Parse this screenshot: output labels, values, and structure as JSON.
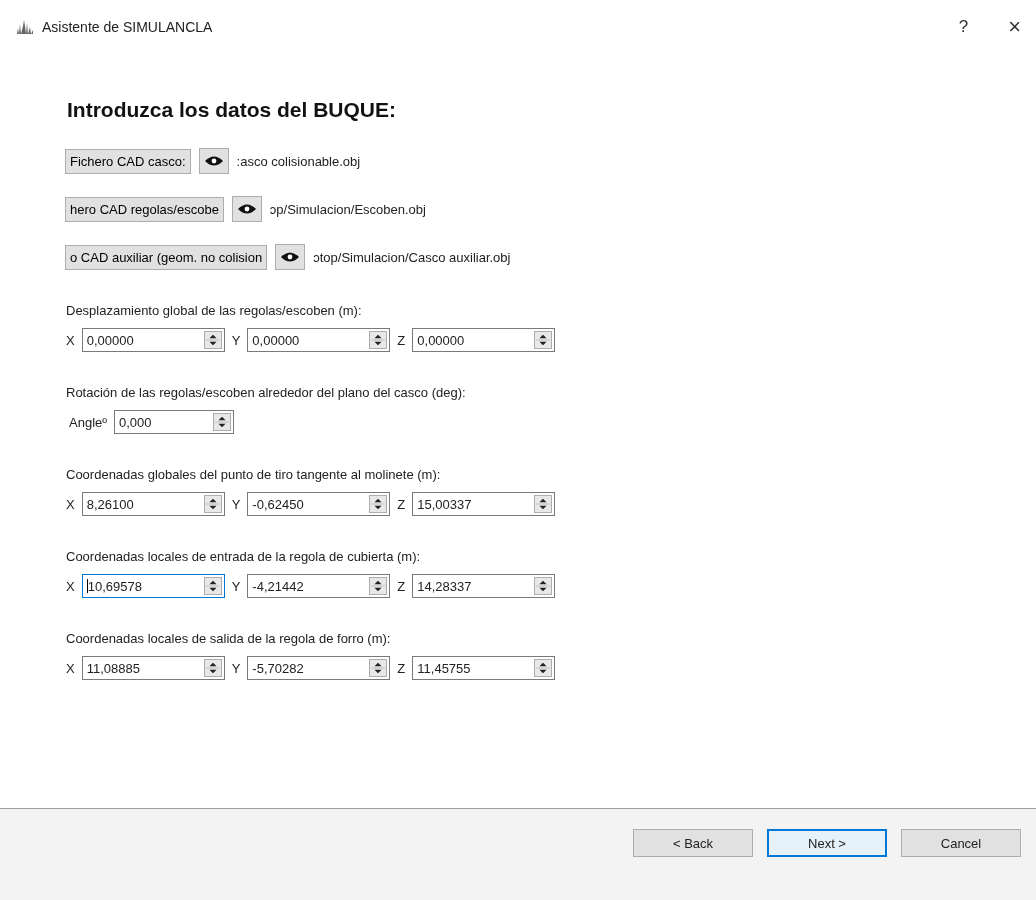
{
  "window": {
    "title": "Asistente de SIMULANCLA",
    "help": "?",
    "close": "×"
  },
  "heading": "Introduzca los datos del BUQUE:",
  "files": [
    {
      "button": "Fichero CAD casco:",
      "path": ":asco colisionable.obj"
    },
    {
      "button": "hero CAD regolas/escobe",
      "path": "ɔp/Simulacion/Escoben.obj"
    },
    {
      "button": "o CAD auxiliar (geom. no colision",
      "path": "ɔtop/Simulacion/Casco auxiliar.obj"
    }
  ],
  "sections": [
    {
      "label": "Desplazamiento global de las regolas/escoben (m):",
      "fields": [
        {
          "axis": "X",
          "value": "0,00000",
          "focused": false
        },
        {
          "axis": "Y",
          "value": "0,00000",
          "focused": false
        },
        {
          "axis": "Z",
          "value": "0,00000",
          "focused": false
        }
      ]
    },
    {
      "label": "Rotación de las regolas/escoben alrededor del plano del casco (deg):",
      "fields": [
        {
          "axis": "Angleº",
          "value": "0,000",
          "focused": false
        }
      ]
    },
    {
      "label": "Coordenadas globales del punto de tiro tangente al molinete (m):",
      "fields": [
        {
          "axis": "X",
          "value": "8,26100",
          "focused": false
        },
        {
          "axis": "Y",
          "value": "-0,62450",
          "focused": false
        },
        {
          "axis": "Z",
          "value": "15,00337",
          "focused": false
        }
      ]
    },
    {
      "label": "Coordenadas locales de entrada de la regola de cubierta (m):",
      "fields": [
        {
          "axis": "X",
          "value": "10,69578",
          "focused": true
        },
        {
          "axis": "Y",
          "value": "-4,21442",
          "focused": false
        },
        {
          "axis": "Z",
          "value": "14,28337",
          "focused": false
        }
      ]
    },
    {
      "label": "Coordenadas locales de salida de la regola de forro (m):",
      "fields": [
        {
          "axis": "X",
          "value": "11,08885",
          "focused": false
        },
        {
          "axis": "Y",
          "value": "-5,70282",
          "focused": false
        },
        {
          "axis": "Z",
          "value": "11,45755",
          "focused": false
        }
      ]
    }
  ],
  "buttons": [
    {
      "label": "< Back",
      "default": false
    },
    {
      "label": "Next >",
      "default": true
    },
    {
      "label": "Cancel",
      "default": false
    }
  ]
}
